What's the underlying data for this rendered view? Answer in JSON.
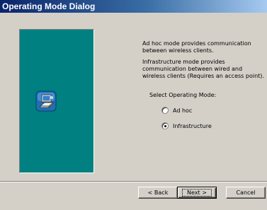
{
  "window": {
    "title": "Operating Mode Dialog"
  },
  "content": {
    "adhoc_description": "Ad hoc mode provides communication between wireless clients.",
    "infrastructure_description": "Infrastructure mode provides communication between wired and wireless clients (Requires an access point).",
    "select_label": "Select Operating Mode:",
    "options": [
      {
        "label": "Ad hoc",
        "selected": false
      },
      {
        "label": "Infrastructure",
        "selected": true
      }
    ]
  },
  "buttons": {
    "back": "< Back",
    "next": "Next >",
    "cancel": "Cancel"
  },
  "icons": {
    "wizard": "network-computer-icon"
  },
  "colors": {
    "panel": "#008080",
    "title_start": "#0a246a",
    "title_end": "#a6caf0",
    "face": "#d4d0c8"
  }
}
